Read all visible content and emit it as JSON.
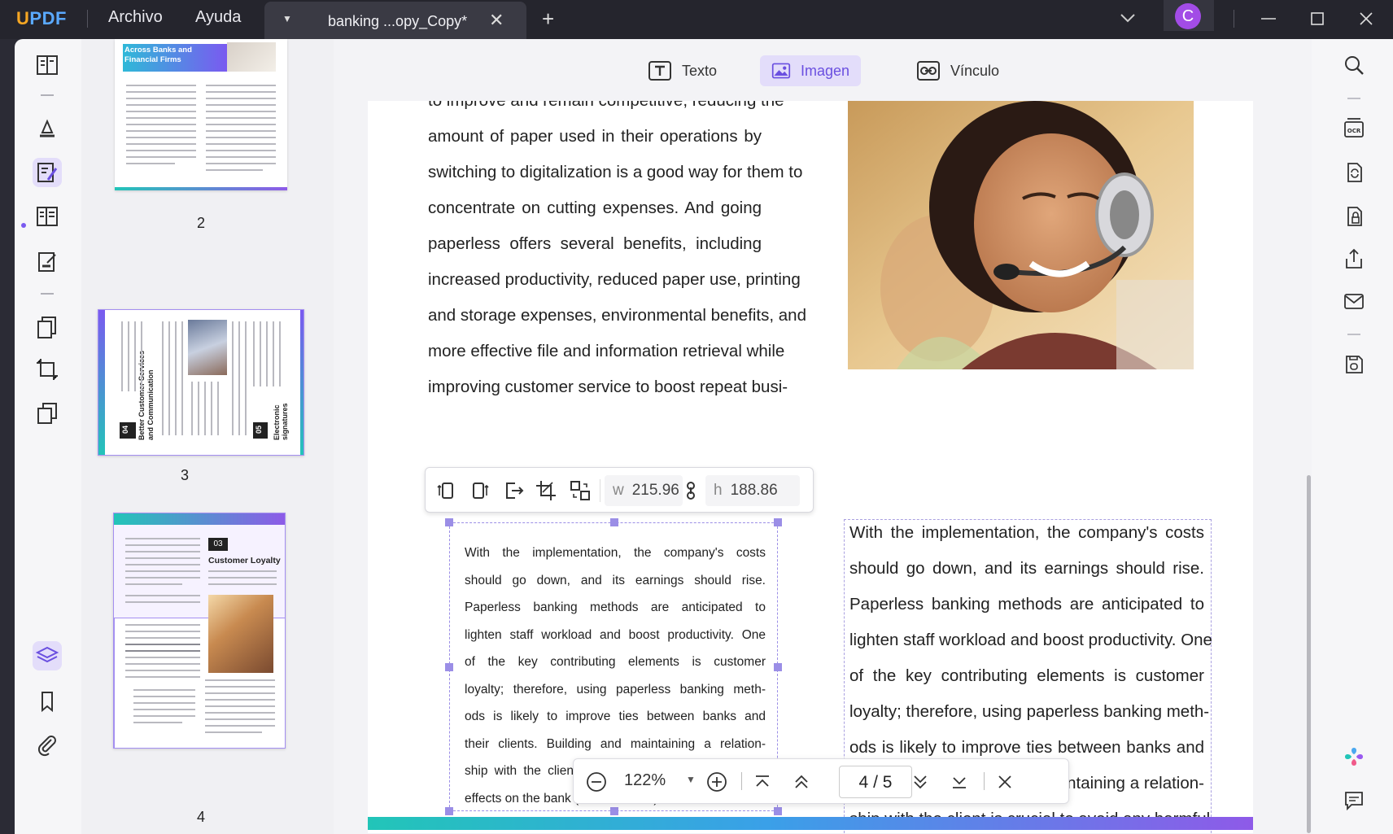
{
  "app": {
    "logo_u": "U",
    "logo_rest": "PDF"
  },
  "menu": {
    "file": "Archivo",
    "help": "Ayuda"
  },
  "tab": {
    "title": "banking ...opy_Copy*",
    "dropdown": "▼",
    "close": "✕"
  },
  "titlebar": {
    "new_tab": "+",
    "avatar_initial": "C"
  },
  "edit_modes": {
    "text": "Texto",
    "image": "Imagen",
    "link": "Vínculo"
  },
  "thumbnails": {
    "pages": [
      {
        "number": "2",
        "heading": "Across Banks and Financial Firms"
      },
      {
        "number": "3",
        "section_a_num": "04",
        "section_a": "Better Customer Services and Communication",
        "section_b_num": "05",
        "section_b": "Electronic signatures"
      },
      {
        "number": "4",
        "section_num": "03",
        "section": "Customer Loyalty"
      }
    ]
  },
  "document": {
    "left_column": [
      "to improve and remain competitive, reducing the",
      "amount of paper used in their operations by",
      "switching to digitalization is a good way for them to",
      "concentrate on cutting expenses. And going",
      "paperless offers several benefits, including",
      "increased productivity, reduced paper use, printing",
      "and storage expenses, environmental benefits, and",
      "more effective file and information retrieval while",
      "improving customer service to boost repeat busi-"
    ],
    "paragraph": [
      "With the implementation, the company's costs",
      "should go down, and its earnings should rise.",
      "Paperless banking methods are anticipated to",
      "lighten staff workload and boost productivity. One",
      "of the key contributing elements is customer",
      "loyalty; therefore, using paperless banking meth-",
      "ods is likely to improve ties between banks and",
      "their clients. Building and maintaining a relation-",
      "ship with the client is crucial to avoid any harmful",
      "effects on the bank (Kumari, 2021)."
    ]
  },
  "image_toolbar": {
    "w_label": "w",
    "w_value": "215.96",
    "h_label": "h",
    "h_value": "188.86"
  },
  "zoom": {
    "value": "122%",
    "dropdown": "▼",
    "page_current": "4",
    "page_sep": "/",
    "page_total": "5"
  },
  "colors": {
    "accent": "#7a5af0",
    "accent_bg": "#e3ddfa",
    "titlebar": "#25252d",
    "avatar": "#a24ce6"
  }
}
